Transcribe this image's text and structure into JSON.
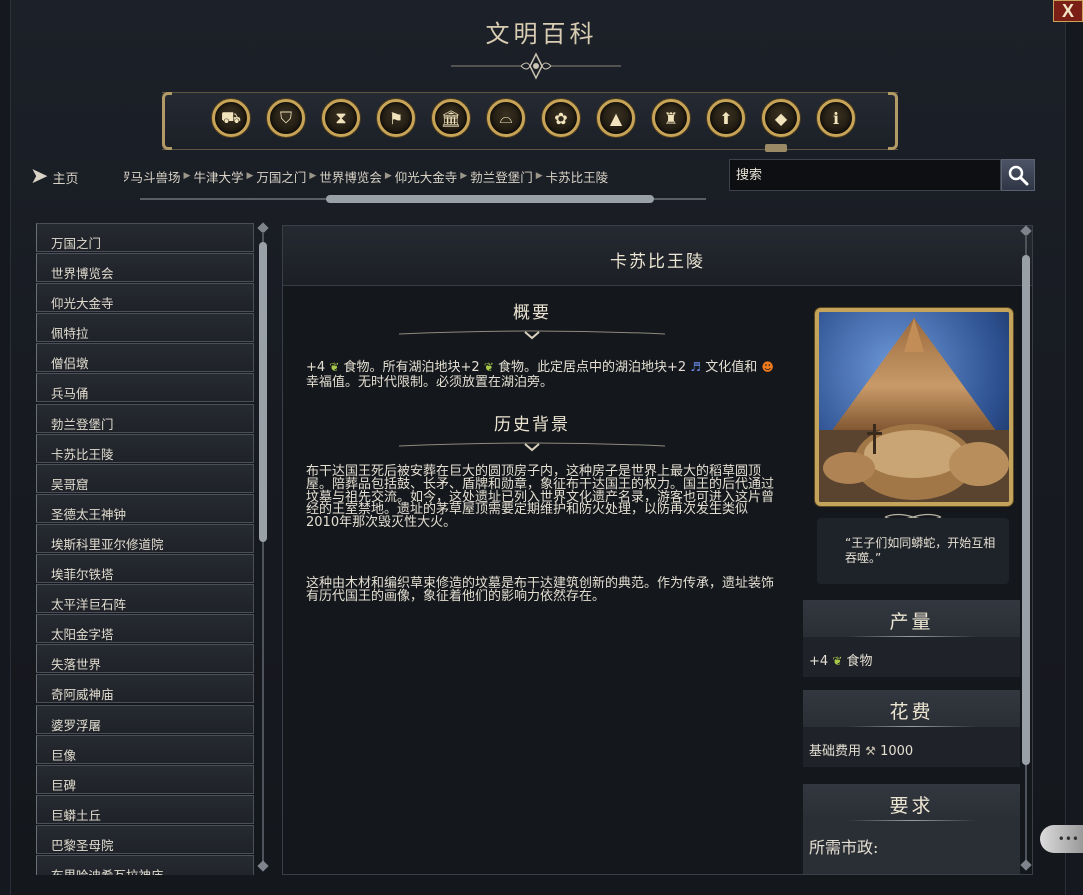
{
  "window": {
    "title": "文明百科",
    "close_label": "X"
  },
  "toolbar": {
    "icons": [
      {
        "name": "civilizations-category-icon",
        "glyph": "⛟"
      },
      {
        "name": "technologies-category-icon",
        "glyph": "⛉"
      },
      {
        "name": "eras-category-icon",
        "glyph": "⧗"
      },
      {
        "name": "leaders-category-icon",
        "glyph": "⚑"
      },
      {
        "name": "buildings-category-icon",
        "glyph": "🏛"
      },
      {
        "name": "districts-category-icon",
        "glyph": "⌓"
      },
      {
        "name": "resources-category-icon",
        "glyph": "✿"
      },
      {
        "name": "terrain-category-icon",
        "glyph": "▲"
      },
      {
        "name": "wonders-category-icon",
        "glyph": "♜"
      },
      {
        "name": "governments-category-icon",
        "glyph": "⬆"
      },
      {
        "name": "units-category-icon",
        "glyph": "◆"
      },
      {
        "name": "concepts-category-icon",
        "glyph": "ℹ"
      }
    ]
  },
  "nav": {
    "home_label": "主页",
    "breadcrumbs": [
      "罗马斗兽场",
      "牛津大学",
      "万国之门",
      "世界博览会",
      "仰光大金寺",
      "勃兰登堡门",
      "卡苏比王陵"
    ],
    "search_placeholder": "搜索"
  },
  "sidebar": {
    "items": [
      {
        "label": "万国之门"
      },
      {
        "label": "世界博览会"
      },
      {
        "label": "仰光大金寺"
      },
      {
        "label": "佩特拉"
      },
      {
        "label": "僧侣墩"
      },
      {
        "label": "兵马俑"
      },
      {
        "label": "勃兰登堡门"
      },
      {
        "label": "卡苏比王陵"
      },
      {
        "label": "吴哥窟"
      },
      {
        "label": "圣德太王神钟"
      },
      {
        "label": "埃斯科里亚尔修道院"
      },
      {
        "label": "埃菲尔铁塔"
      },
      {
        "label": "太平洋巨石阵"
      },
      {
        "label": "太阳金字塔"
      },
      {
        "label": "失落世界"
      },
      {
        "label": "奇阿威神庙"
      },
      {
        "label": "婆罗浮屠"
      },
      {
        "label": "巨像"
      },
      {
        "label": "巨碑"
      },
      {
        "label": "巨蟒土丘"
      },
      {
        "label": "巴黎圣母院"
      },
      {
        "label": "布里哈迪希瓦拉神庙"
      }
    ]
  },
  "article": {
    "title": "卡苏比王陵",
    "overview_heading": "概要",
    "overview": {
      "p1": "+4",
      "p2": " 食物。所有湖泊地块+2",
      "p3": " 食物。此定居点中的湖泊地块+2",
      "p4": " 文化值和",
      "p5": " 幸福值。无时代限制。必须放置在湖泊旁。"
    },
    "history_heading": "历史背景",
    "history_p1": "布干达国王死后被安葬在巨大的圆顶房子内，这种房子是世界上最大的稻草圆顶屋。陪葬品包括鼓、长矛、盾牌和勋章，象征布干达国王的权力。国王的后代通过坟墓与祖先交流。如今，这处遗址已列入世界文化遗产名录，游客也可进入这片曾经的王室禁地。遗址的茅草屋顶需要定期维护和防火处理，以防再次发生类似2010年那次毁灭性大火。",
    "history_p2": "这种由木材和编织草束修造的坟墓是布干达建筑创新的典范。作为传承，遗址装饰有历代国王的画像，象征着他们的影响力依然存在。",
    "quote": "“王子们如同蟒蛇，开始互相吞噬。”"
  },
  "stats": {
    "yield_title": "产量",
    "yield_prefix": "+4",
    "yield_label": "食物",
    "cost_title": "花费",
    "cost_label": "基础费用",
    "cost_value": "1000",
    "req_title": "要求",
    "req_label": "所需市政:"
  },
  "colors": {
    "gold_accent": "#c8a458",
    "food": "#a8c94a",
    "culture": "#6c8ff0",
    "amenity": "#f07a1c"
  }
}
